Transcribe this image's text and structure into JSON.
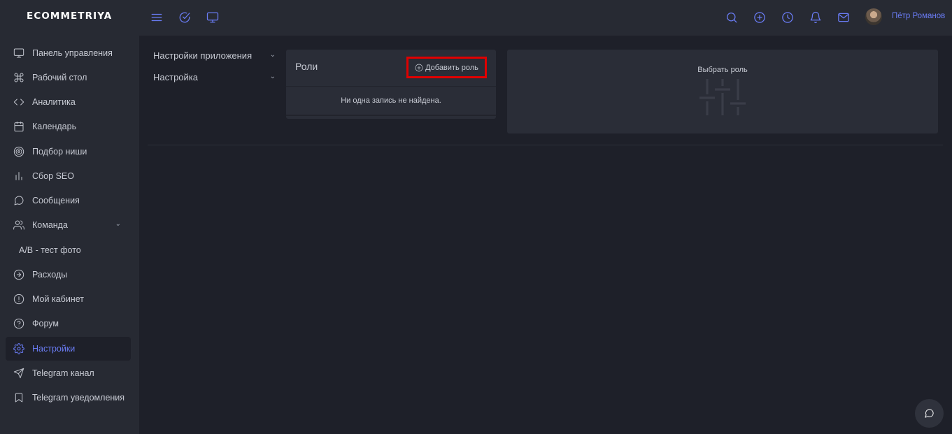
{
  "app": {
    "logo": "ECOMMETRIYA"
  },
  "topbar": {
    "left_icons": [
      "menu-icon",
      "check-circle-icon",
      "monitor-icon"
    ],
    "right_icons": [
      "search-icon",
      "plus-circle-icon",
      "clock-icon",
      "bell-icon",
      "mail-icon"
    ],
    "user_name": "Пётр Романов"
  },
  "sidebar": {
    "items": [
      {
        "label": "Панель управления",
        "icon": "monitor-icon"
      },
      {
        "label": "Рабочий стол",
        "icon": "command-icon"
      },
      {
        "label": "Аналитика",
        "icon": "code-icon"
      },
      {
        "label": "Календарь",
        "icon": "calendar-icon"
      },
      {
        "label": "Подбор ниши",
        "icon": "target-icon"
      },
      {
        "label": "Сбор SEO",
        "icon": "bar-chart-icon"
      },
      {
        "label": "Сообщения",
        "icon": "message-circle-icon"
      },
      {
        "label": "Команда",
        "icon": "users-icon",
        "expandable": true
      },
      {
        "label": "A/B - тест фото",
        "icon": ""
      },
      {
        "label": "Расходы",
        "icon": "arrow-right-circle-icon"
      },
      {
        "label": "Мой кабинет",
        "icon": "alert-circle-icon"
      },
      {
        "label": "Форум",
        "icon": "help-circle-icon"
      },
      {
        "label": "Настройки",
        "icon": "settings-icon",
        "active": true
      },
      {
        "label": "Telegram канал",
        "icon": "send-icon"
      },
      {
        "label": "Telegram уведомления",
        "icon": "bookmark-icon"
      }
    ]
  },
  "settings_menu": {
    "items": [
      {
        "label": "Настройки приложения"
      },
      {
        "label": "Настройка"
      }
    ]
  },
  "roles_panel": {
    "title": "Роли",
    "add_button": "Добавить роль",
    "empty_text": "Ни одна запись не найдена."
  },
  "select_role_panel": {
    "title": "Выбрать роль",
    "icon": "sliders-icon"
  },
  "chat": {
    "icon": "message-circle-icon"
  },
  "colors": {
    "accent": "#6a7cf5",
    "background": "#1e2029",
    "panel": "#272a33",
    "highlight_border": "#e00000"
  }
}
